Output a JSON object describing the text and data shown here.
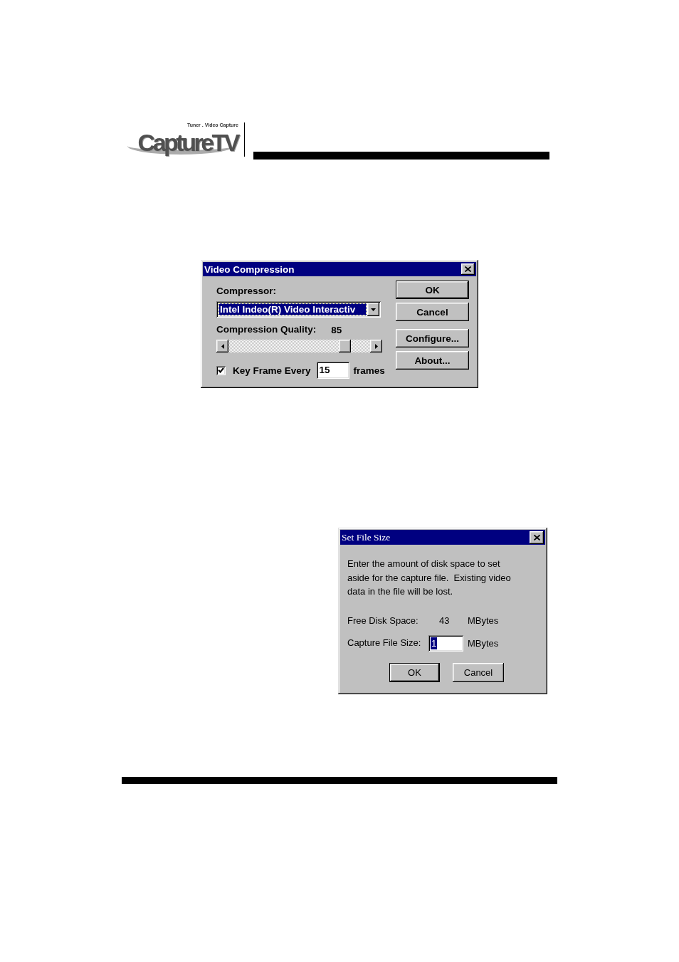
{
  "header": {
    "logo": {
      "tagline": "Tuner . Video Capture",
      "wordmark": "CaptureTV"
    }
  },
  "video_compression_dialog": {
    "title": "Video Compression",
    "compressor": {
      "label": "Compressor:",
      "value": "Intel Indeo(R) Video Interactiv",
      "highlighted": true
    },
    "quality": {
      "label": "Compression Quality:",
      "reading": "85",
      "level": 0.85
    },
    "key_frame": {
      "label": "Key Frame Every",
      "checked": true,
      "value": "15",
      "unit": "frames"
    },
    "buttons": [
      {
        "label": "OK",
        "default": true
      },
      {
        "label": "Cancel",
        "default": false
      },
      {
        "label": "Configure...",
        "default": false
      },
      {
        "label": "About...",
        "default": false
      }
    ]
  },
  "set_file_size_dialog": {
    "title": "Set File Size",
    "message": "Enter the amount of disk space to set\naside for the capture file.  Existing video\ndata in the file will be lost.",
    "fields": [
      {
        "kind": "readout",
        "label": "Free Disk Space:",
        "value": "43",
        "unit": "MBytes"
      },
      {
        "kind": "input",
        "label": "Capture File Size:",
        "value": "1",
        "highlighted": true,
        "unit": "MBytes"
      }
    ],
    "buttons": [
      {
        "label": "OK",
        "default": true
      },
      {
        "label": "Cancel",
        "default": false
      }
    ]
  }
}
